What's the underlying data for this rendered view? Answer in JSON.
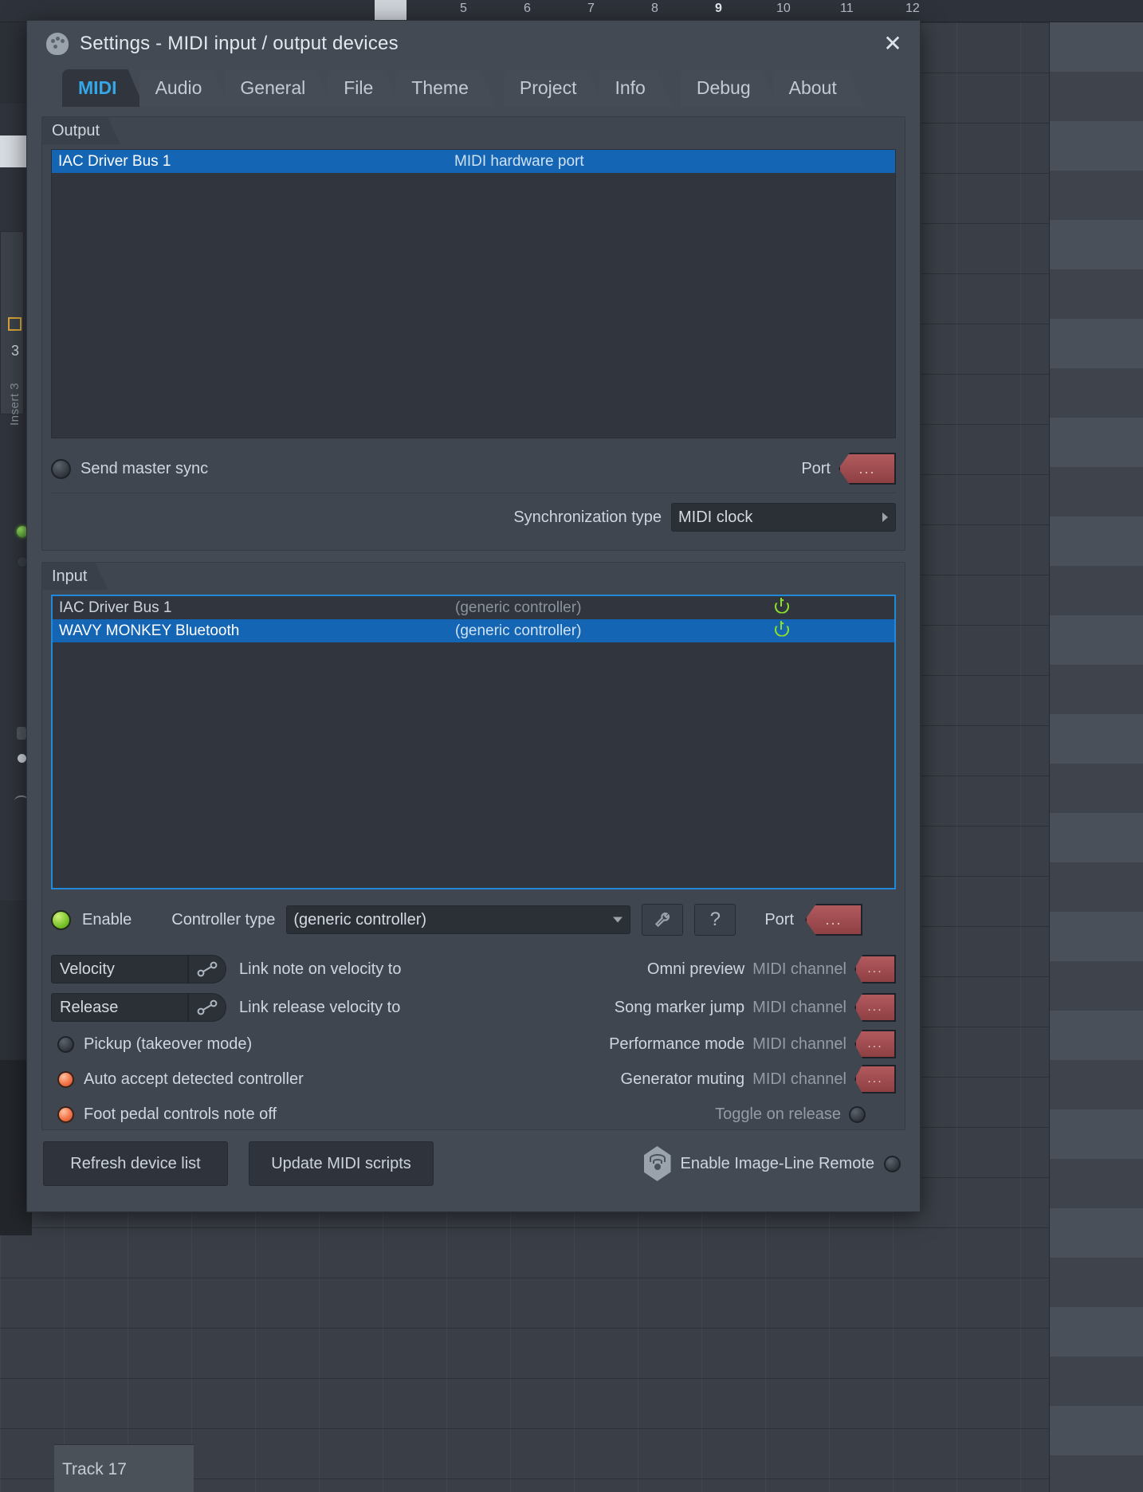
{
  "background": {
    "ruler_ticks": [
      "5",
      "6",
      "7",
      "8",
      "9",
      "10",
      "11",
      "12"
    ],
    "insert_label": "Insert 3",
    "insert_number": "3",
    "track_label": "Track 17"
  },
  "window": {
    "title": "Settings - MIDI input / output devices",
    "icon": "fl-settings-icon",
    "close_label": "✕"
  },
  "tabs": [
    {
      "label": "MIDI",
      "active": true
    },
    {
      "label": "Audio",
      "active": false
    },
    {
      "label": "General",
      "active": false
    },
    {
      "label": "File",
      "active": false
    },
    {
      "label": "Theme",
      "active": false
    },
    {
      "label": "Project",
      "active": false
    },
    {
      "label": "Info",
      "active": false
    },
    {
      "label": "Debug",
      "active": false
    },
    {
      "label": "About",
      "active": false
    }
  ],
  "output": {
    "group_label": "Output",
    "devices": [
      {
        "name": "IAC Driver Bus 1",
        "type": "MIDI hardware port",
        "selected": true
      }
    ],
    "send_master_sync_label": "Send master sync",
    "send_master_sync_on": false,
    "port_label": "Port",
    "port_value": "...",
    "sync_type_label": "Synchronization type",
    "sync_type_value": "MIDI clock"
  },
  "input": {
    "group_label": "Input",
    "devices": [
      {
        "name": "IAC Driver Bus 1",
        "type": "(generic controller)",
        "selected": false,
        "enabled": true
      },
      {
        "name": "WAVY MONKEY Bluetooth",
        "type": "(generic controller)",
        "selected": true,
        "enabled": true
      }
    ],
    "enable_label": "Enable",
    "enable_on": true,
    "controller_type_label": "Controller type",
    "controller_type_value": "(generic controller)",
    "wrench_icon": "wrench-icon",
    "help_label": "?",
    "port_label": "Port",
    "port_value": "...",
    "links": [
      {
        "field": "Velocity",
        "label": "Link note on velocity to"
      },
      {
        "field": "Release",
        "label": "Link release velocity to"
      }
    ],
    "options": [
      {
        "label": "Pickup (takeover mode)",
        "on": false
      },
      {
        "label": "Auto accept detected controller",
        "on": true
      },
      {
        "label": "Foot pedal controls note off",
        "on": true
      }
    ],
    "channels": [
      {
        "label": "Omni preview",
        "suffix": "MIDI channel",
        "value": "..."
      },
      {
        "label": "Song marker jump",
        "suffix": "MIDI channel",
        "value": "..."
      },
      {
        "label": "Performance mode",
        "suffix": "MIDI channel",
        "value": "..."
      },
      {
        "label": "Generator muting",
        "suffix": "MIDI channel",
        "value": "..."
      }
    ],
    "toggle_on_release_label": "Toggle on release",
    "toggle_on_release_on": false
  },
  "footer": {
    "refresh_label": "Refresh device list",
    "update_label": "Update MIDI scripts",
    "remote_label": "Enable Image-Line Remote",
    "remote_on": false,
    "remote_icon": "image-line-remote-icon"
  },
  "colors": {
    "accent_blue": "#35a7e8",
    "selection_blue": "#1565b5",
    "port_red": "#a44e52",
    "led_green": "#8ce02a",
    "led_orange": "#f2764a"
  }
}
